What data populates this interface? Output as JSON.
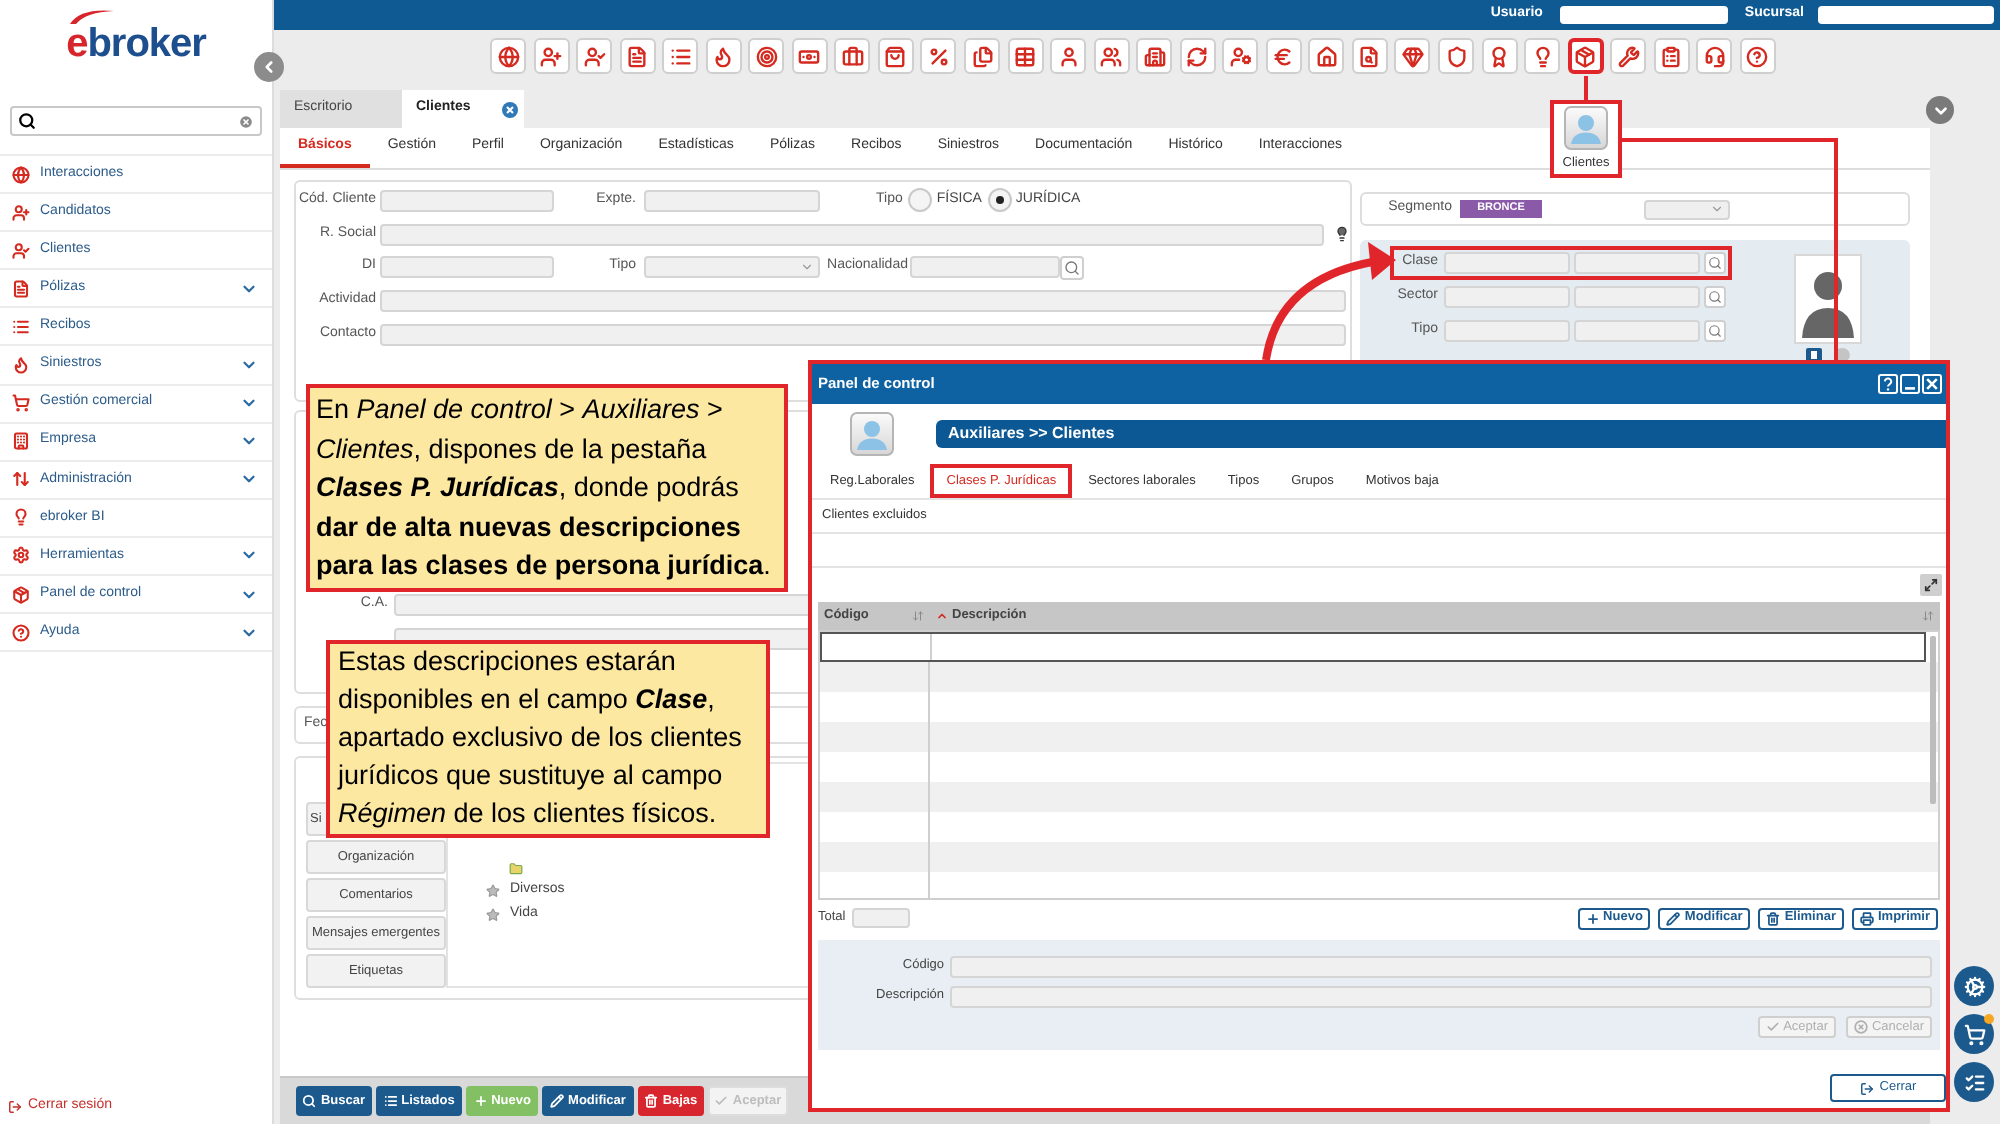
{
  "sidebar": {
    "logo": "ebroker",
    "items": [
      {
        "label": "Interacciones",
        "has_submenu": false
      },
      {
        "label": "Candidatos",
        "has_submenu": false
      },
      {
        "label": "Clientes",
        "has_submenu": false
      },
      {
        "label": "Pólizas",
        "has_submenu": true
      },
      {
        "label": "Recibos",
        "has_submenu": false
      },
      {
        "label": "Siniestros",
        "has_submenu": true
      },
      {
        "label": "Gestión comercial",
        "has_submenu": true
      },
      {
        "label": "Empresa",
        "has_submenu": true
      },
      {
        "label": "Administración",
        "has_submenu": true
      },
      {
        "label": "ebroker BI",
        "has_submenu": false
      },
      {
        "label": "Herramientas",
        "has_submenu": true
      },
      {
        "label": "Panel de control",
        "has_submenu": true
      },
      {
        "label": "Ayuda",
        "has_submenu": true
      }
    ],
    "logout": "Cerrar sesión"
  },
  "top_bar": {
    "user_label": "Usuario",
    "branch_label": "Sucursal"
  },
  "toolbar": [
    {
      "highlighted": false
    },
    {
      "highlighted": false
    },
    {
      "highlighted": false
    },
    {
      "highlighted": false
    },
    {
      "highlighted": false
    },
    {
      "highlighted": false
    },
    {
      "highlighted": false
    },
    {
      "highlighted": false
    },
    {
      "highlighted": false
    },
    {
      "highlighted": false
    },
    {
      "highlighted": false
    },
    {
      "highlighted": false
    },
    {
      "highlighted": false
    },
    {
      "highlighted": false
    },
    {
      "highlighted": false
    },
    {
      "highlighted": false
    },
    {
      "highlighted": false
    },
    {
      "highlighted": false
    },
    {
      "highlighted": false
    },
    {
      "highlighted": false
    },
    {
      "highlighted": false
    },
    {
      "highlighted": false
    },
    {
      "highlighted": false
    },
    {
      "highlighted": false
    },
    {
      "highlighted": false
    },
    {
      "highlighted": true
    },
    {
      "highlighted": false
    },
    {
      "highlighted": false
    },
    {
      "highlighted": false
    },
    {
      "highlighted": false
    }
  ],
  "toolbar_popup": {
    "label": "Clientes"
  },
  "document_tabs": [
    {
      "label": "Escritorio",
      "selected": false,
      "closable": false
    },
    {
      "label": "Clientes",
      "selected": true,
      "closable": true
    }
  ],
  "section_tabs": [
    {
      "label": "Básicos",
      "selected": true
    },
    {
      "label": "Gestión",
      "selected": false
    },
    {
      "label": "Perfil",
      "selected": false
    },
    {
      "label": "Organización",
      "selected": false
    },
    {
      "label": "Estadísticas",
      "selected": false
    },
    {
      "label": "Pólizas",
      "selected": false
    },
    {
      "label": "Recibos",
      "selected": false
    },
    {
      "label": "Siniestros",
      "selected": false
    },
    {
      "label": "Documentación",
      "selected": false
    },
    {
      "label": "Histórico",
      "selected": false
    },
    {
      "label": "Interacciones",
      "selected": false
    }
  ],
  "client_form": {
    "code_label": "Cód. Cliente",
    "file_label": "Expte.",
    "person_type": {
      "label": "Tipo",
      "options": [
        {
          "label": "FÍSICA",
          "selected": false
        },
        {
          "label": "JURÍDICA",
          "selected": true
        }
      ]
    },
    "name_label": "R. Social",
    "id_label": "DI",
    "id_type_label": "Tipo",
    "nationality_label": "Nacionalidad",
    "activity_label": "Actividad",
    "contact_label": "Contacto"
  },
  "segment": {
    "label": "Segmento",
    "badge": "BRONCE"
  },
  "classification": [
    {
      "label": "Clase",
      "highlighted": true
    },
    {
      "label": "Sector",
      "highlighted": false
    },
    {
      "label": "Tipo",
      "highlighted": false
    }
  ],
  "address": {
    "label": "C.A."
  },
  "date_row": {
    "label": "Fec"
  },
  "side_buttons": {
    "covered_button": "Si",
    "items": [
      "Organización",
      "Comentarios",
      "Mensajes emergentes",
      "Etiquetas"
    ]
  },
  "tree": [
    "Diversos",
    "Vida"
  ],
  "bottom_toolbar": [
    {
      "label": "Buscar",
      "kind": "search",
      "disabled": false
    },
    {
      "label": "Listados",
      "kind": "list",
      "disabled": false
    },
    {
      "label": "Nuevo",
      "kind": "new",
      "disabled": false
    },
    {
      "label": "Modificar",
      "kind": "edit",
      "disabled": false
    },
    {
      "label": "Bajas",
      "kind": "delete",
      "disabled": false
    },
    {
      "label": "Aceptar",
      "kind": "accept",
      "disabled": true
    }
  ],
  "callouts": [
    {
      "parts": [
        {
          "kind": "text",
          "text": "En *Panel de control* > *Auxiliares* > *Clientes*, dispones de la pestaña "
        },
        {
          "kind": "emphasis",
          "text": "Clases P. Jurídicas"
        },
        {
          "kind": "text",
          "text": ", donde podrás **dar de alta nuevas descripciones para las clases de persona jurídica**."
        }
      ]
    },
    {
      "parts": [
        {
          "kind": "text",
          "text": "Estas descripciones estarán disponibles en el campo "
        },
        {
          "kind": "emphasis",
          "text": "Clase"
        },
        {
          "kind": "text",
          "text": ", apartado exclusivo de los clientes jurídicos que sustituye al campo *Régimen* de los clientes físicos."
        }
      ]
    }
  ],
  "dialog": {
    "title": "Panel de control",
    "header": "Auxiliares >> Clientes",
    "tabs": [
      {
        "label": "Reg.Laborales",
        "selected": false
      },
      {
        "label": "Clases P. Jurídicas",
        "selected": true
      },
      {
        "label": "Sectores laborales",
        "selected": false
      },
      {
        "label": "Tipos",
        "selected": false
      },
      {
        "label": "Grupos",
        "selected": false
      },
      {
        "label": "Motivos baja",
        "selected": false
      }
    ],
    "subtab": "Clientes excluidos",
    "table": {
      "columns": [
        {
          "label": "Código",
          "sorted": false
        },
        {
          "label": "Descripción",
          "sorted": true
        }
      ]
    },
    "total_label": "Total",
    "actions": [
      {
        "label": "Nuevo",
        "kind": "new"
      },
      {
        "label": "Modificar",
        "kind": "edit"
      },
      {
        "label": "Eliminar",
        "kind": "delete"
      },
      {
        "label": "Imprimir",
        "kind": "print"
      }
    ],
    "form": {
      "fields": [
        {
          "label": "Código"
        },
        {
          "label": "Descripción"
        }
      ],
      "buttons": [
        {
          "label": "Aceptar",
          "kind": "accept",
          "disabled": true
        },
        {
          "label": "Cancelar",
          "kind": "cancel",
          "disabled": true
        }
      ]
    },
    "close_button": "Cerrar"
  }
}
